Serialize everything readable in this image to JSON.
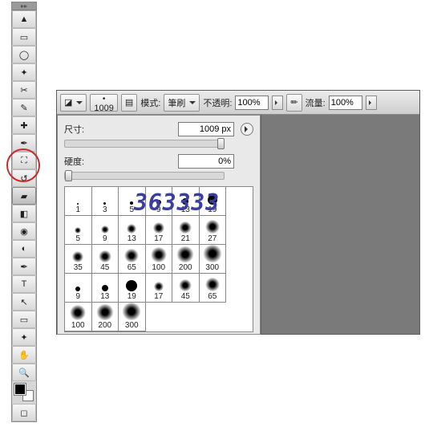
{
  "toolbar": {
    "tools": [
      {
        "name": "move-tool",
        "glyph": "▲"
      },
      {
        "name": "marquee-tool",
        "glyph": "▭"
      },
      {
        "name": "lasso-tool",
        "glyph": "◯"
      },
      {
        "name": "wand-tool",
        "glyph": "✦"
      },
      {
        "name": "crop-tool",
        "glyph": "✂"
      },
      {
        "name": "eyedropper-tool",
        "glyph": "✎"
      },
      {
        "name": "healing-tool",
        "glyph": "✚"
      },
      {
        "name": "brush-tool",
        "glyph": "✒"
      },
      {
        "name": "stamp-tool",
        "glyph": "⛶"
      },
      {
        "name": "history-brush-tool",
        "glyph": "↺"
      },
      {
        "name": "eraser-tool",
        "glyph": "▰",
        "selected": true
      },
      {
        "name": "gradient-tool",
        "glyph": "◧"
      },
      {
        "name": "blur-tool",
        "glyph": "◉"
      },
      {
        "name": "dodge-tool",
        "glyph": "◐"
      },
      {
        "name": "pen-tool",
        "glyph": "✒"
      },
      {
        "name": "type-tool",
        "glyph": "T"
      },
      {
        "name": "path-tool",
        "glyph": "↖"
      },
      {
        "name": "shape-tool",
        "glyph": "▭"
      },
      {
        "name": "3d-tool",
        "glyph": "✦"
      },
      {
        "name": "hand-tool",
        "glyph": "✋"
      },
      {
        "name": "zoom-tool",
        "glyph": "🔍"
      }
    ],
    "extra": [
      {
        "name": "quick-mask-tool",
        "glyph": "◻"
      }
    ]
  },
  "options": {
    "brush_size_num": "1009",
    "mode_label": "模式:",
    "mode_value": "筆刷",
    "opacity_label": "不透明:",
    "opacity_value": "100%",
    "flow_label": "流量:",
    "flow_value": "100%"
  },
  "popup": {
    "size_label": "尺寸:",
    "size_value": "1009 px",
    "hardness_label": "硬度:",
    "hardness_value": "0%",
    "presets": [
      {
        "v": "1",
        "s": 2,
        "soft": false
      },
      {
        "v": "3",
        "s": 3,
        "soft": false
      },
      {
        "v": "5",
        "s": 4,
        "soft": false
      },
      {
        "v": "9",
        "s": 6,
        "soft": false
      },
      {
        "v": "13",
        "s": 8,
        "soft": false
      },
      {
        "v": "19",
        "s": 12,
        "soft": false
      },
      {
        "v": "5",
        "s": 8,
        "soft": true
      },
      {
        "v": "9",
        "s": 10,
        "soft": true
      },
      {
        "v": "13",
        "s": 12,
        "soft": true
      },
      {
        "v": "17",
        "s": 14,
        "soft": true
      },
      {
        "v": "21",
        "s": 16,
        "soft": true
      },
      {
        "v": "27",
        "s": 18,
        "soft": true
      },
      {
        "v": "35",
        "s": 14,
        "soft": true
      },
      {
        "v": "45",
        "s": 16,
        "soft": true
      },
      {
        "v": "65",
        "s": 18,
        "soft": true
      },
      {
        "v": "100",
        "s": 20,
        "soft": true
      },
      {
        "v": "200",
        "s": 22,
        "soft": true
      },
      {
        "v": "300",
        "s": 24,
        "soft": true
      },
      {
        "v": "9",
        "s": 6,
        "soft": false
      },
      {
        "v": "13",
        "s": 8,
        "soft": false
      },
      {
        "v": "19",
        "s": 14,
        "soft": false
      },
      {
        "v": "17",
        "s": 12,
        "soft": true
      },
      {
        "v": "45",
        "s": 16,
        "soft": true
      },
      {
        "v": "65",
        "s": 18,
        "soft": true
      },
      {
        "v": "100",
        "s": 20,
        "soft": true
      },
      {
        "v": "200",
        "s": 22,
        "soft": true
      },
      {
        "v": "300",
        "s": 24,
        "soft": true
      }
    ]
  },
  "watermark": "363333"
}
